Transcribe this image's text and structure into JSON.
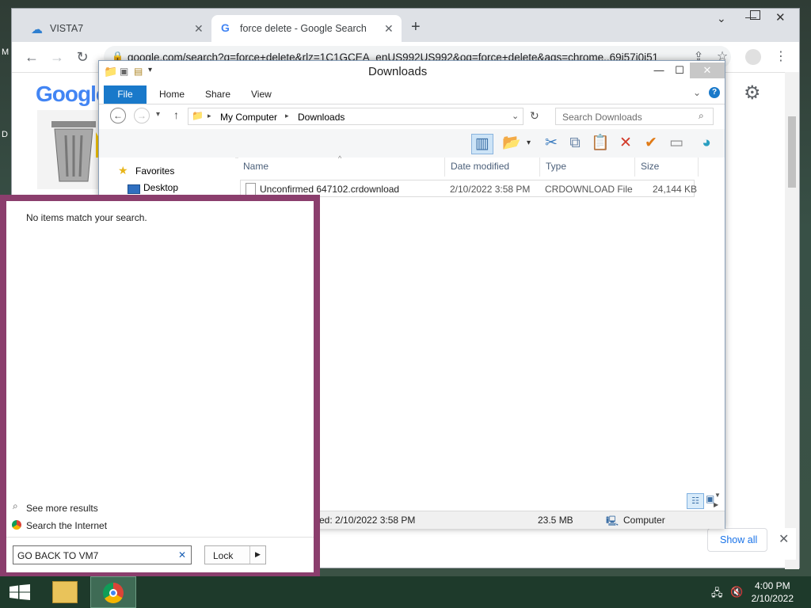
{
  "desktop": {
    "edge_letters": [
      "M",
      "D"
    ]
  },
  "chrome": {
    "tabs": [
      {
        "title": "VISTA7",
        "icon": "vista-icon"
      },
      {
        "title": "force delete - Google Search",
        "icon": "google-g-icon"
      }
    ],
    "new_tab_symbol": "+",
    "url": "google.com/search?q=force+delete&rlz=1C1GCEA_enUS992US992&oq=force+delete&aqs=chrome..69i57j0i51",
    "google_logo": "Google",
    "show_all_label": "Show all"
  },
  "explorer": {
    "title": "Downloads",
    "ribbon": {
      "file": "File",
      "tabs": [
        "Home",
        "Share",
        "View"
      ]
    },
    "breadcrumb": [
      "My Computer",
      "Downloads"
    ],
    "search_placeholder": "Search Downloads",
    "nav": {
      "favorites": "Favorites",
      "desktop": "Desktop"
    },
    "columns": [
      "Name",
      "Date modified",
      "Type",
      "Size"
    ],
    "files": [
      {
        "name": "Unconfirmed 647102.crdownload",
        "date": "2/10/2022 3:58 PM",
        "type": "CRDOWNLOAD File",
        "size": "24,144 KB"
      }
    ],
    "status": {
      "modified": "fied: 2/10/2022 3:58 PM",
      "size": "23.5 MB",
      "location": "Computer"
    }
  },
  "start_search": {
    "no_results": "No items match your search.",
    "see_more": "See more results",
    "search_internet": "Search the Internet",
    "query": "GO BACK TO VM7",
    "lock_label": "Lock"
  },
  "taskbar": {
    "time": "4:00 PM",
    "date": "2/10/2022"
  },
  "colors": {
    "accent_blue": "#1979ca",
    "start_border": "#8b3e6d",
    "taskbar": "#1e3a2b"
  }
}
